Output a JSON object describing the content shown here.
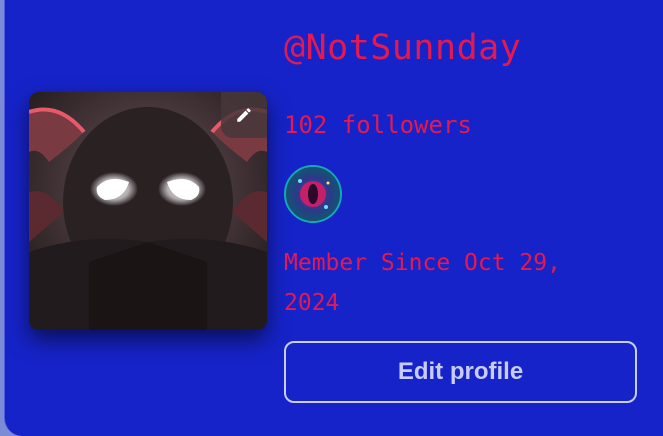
{
  "profile": {
    "username": "@NotSunnday",
    "followers": "102 followers",
    "member_since": "Member Since Oct 29, 2024",
    "edit_button_label": "Edit profile"
  },
  "icons": {
    "edit_avatar": "pencil-icon",
    "badge": "badge-icon"
  },
  "colors": {
    "card_background": "#1623c8",
    "accent_text": "#e5194f",
    "button_text": "#c8cdf5"
  }
}
